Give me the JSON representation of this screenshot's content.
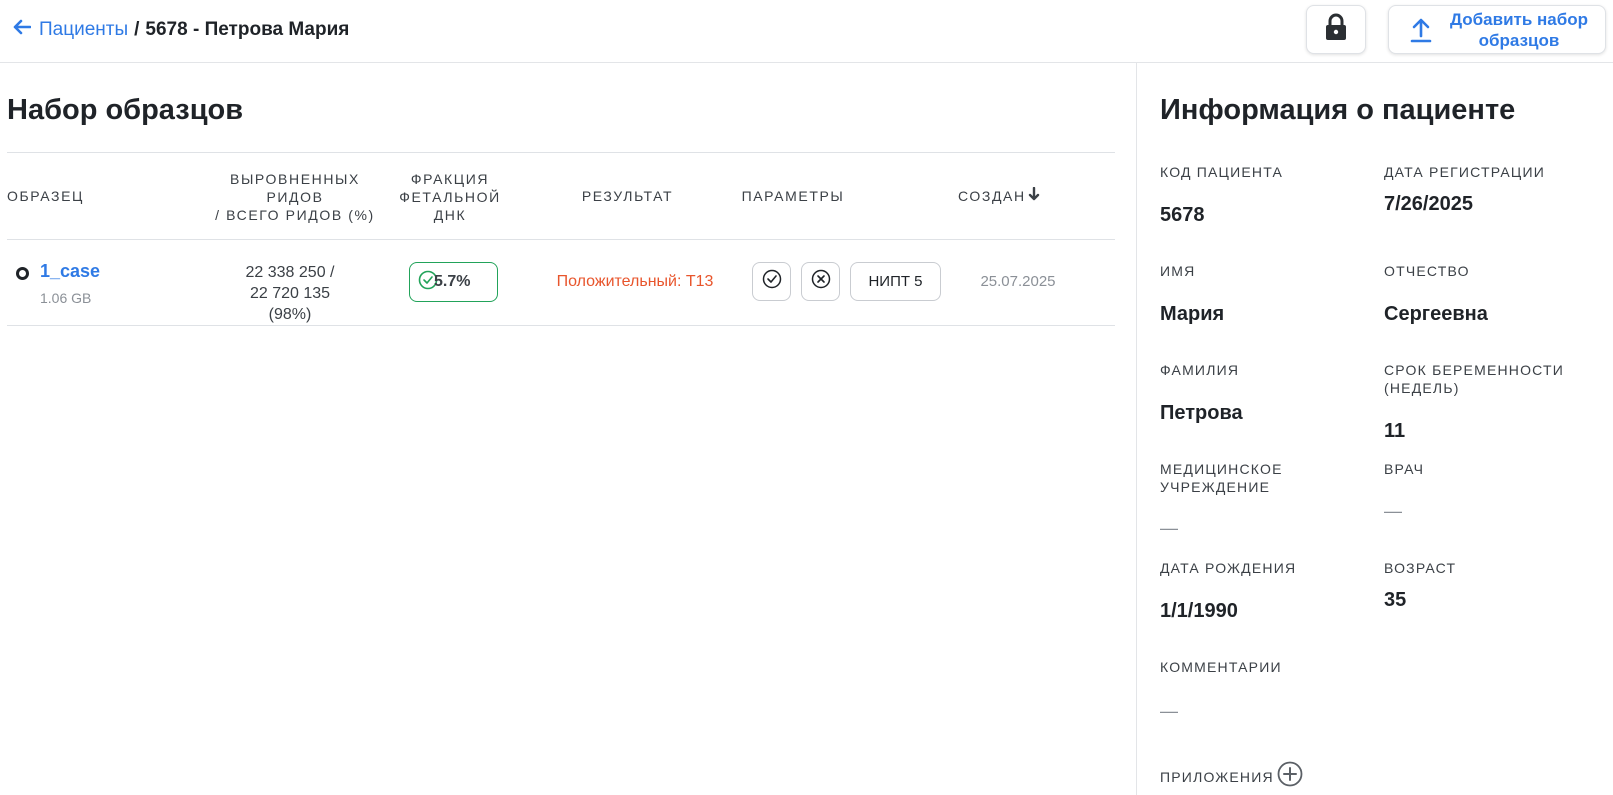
{
  "breadcrumb": {
    "parent": "Пациенты",
    "separator": "/",
    "current": "5678 - Петрова Мария"
  },
  "toolbar": {
    "lock_icon": "lock-icon",
    "upload_label": "Добавить набор образцов",
    "upload_icon": "upload-icon"
  },
  "samples": {
    "title": "Набор образцов",
    "columns": {
      "sample": "ОБРАЗЕЦ",
      "reads_line1": "ВЫРОВНЕННЫХ РИДОВ",
      "reads_line2": "/ ВСЕГО РИДОВ (%)",
      "fetal": "ФРАКЦИЯ ФЕТАЛЬНОЙ ДНК",
      "result": "РЕЗУЛЬТАТ",
      "params": "ПАРАМЕТРЫ",
      "created": "СОЗДАН"
    },
    "rows": [
      {
        "name": "1_case",
        "size": "1.06 GB",
        "reads_aligned": "22 338 250 /",
        "reads_total": "22 720 135",
        "reads_pct": "(98%)",
        "fetal_fraction": "5.7%",
        "result": "Положительный: T13",
        "param_label": "НИПТ 5",
        "created": "25.07.2025"
      }
    ]
  },
  "patient": {
    "title": "Информация о пациенте",
    "fields": {
      "code_label": "КОД ПАЦИЕНТА",
      "code": "5678",
      "reg_date_label": "ДАТА РЕГИСТРАЦИИ",
      "reg_date": "7/26/2025",
      "first_name_label": "ИМЯ",
      "first_name": "Мария",
      "patronymic_label": "ОТЧЕСТВО",
      "patronymic": "Сергеевна",
      "last_name_label": "ФАМИЛИЯ",
      "last_name": "Петрова",
      "gestation_label": "СРОК БЕРЕМЕННОСТИ (НЕДЕЛЬ)",
      "gestation": "11",
      "institution_label": "МЕДИЦИНСКОЕ УЧРЕЖДЕНИЕ",
      "institution": "—",
      "doctor_label": "ВРАЧ",
      "doctor": "—",
      "birth_label": "ДАТА РОЖДЕНИЯ",
      "birth": "1/1/1990",
      "age_label": "ВОЗРАСТ",
      "age": "35",
      "comments_label": "КОММЕНТАРИИ",
      "comments": "—",
      "attachments_label": "ПРИЛОЖЕНИЯ"
    }
  },
  "colors": {
    "link": "#2f7ae5",
    "positive": "#e8552c",
    "ok": "#22a35a"
  }
}
